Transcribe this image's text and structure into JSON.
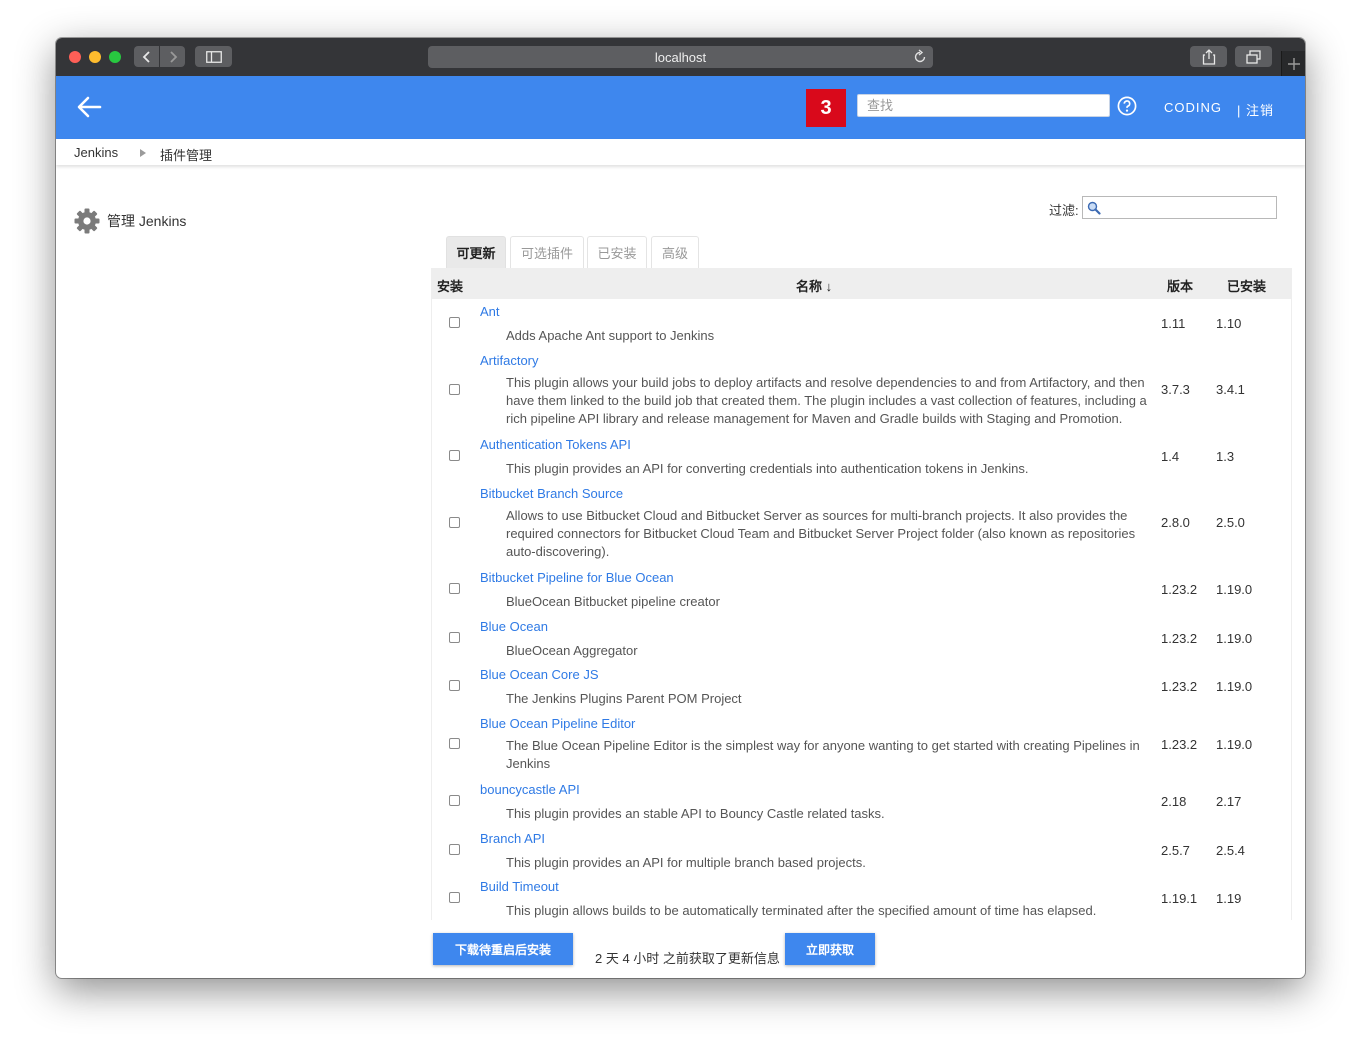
{
  "browser": {
    "url": "localhost"
  },
  "header": {
    "notification_count": "3",
    "search_placeholder": "查找",
    "user_link": "CODING",
    "logout_link": "| 注销"
  },
  "breadcrumb": [
    "Jenkins",
    "插件管理"
  ],
  "sidebar": {
    "manage_label": "管理 Jenkins"
  },
  "filter": {
    "label": "过滤:",
    "value": ""
  },
  "tabs": [
    "可更新",
    "可选插件",
    "已安装",
    "高级"
  ],
  "table": {
    "headers": {
      "install": "安装",
      "name": "名称 ↓",
      "version": "版本",
      "installed": "已安装"
    },
    "rows": [
      {
        "name": "Ant",
        "desc": "Adds Apache Ant support to Jenkins",
        "version": "1.11",
        "installed": "1.10"
      },
      {
        "name": "Artifactory",
        "desc": "This plugin allows your build jobs to deploy artifacts and resolve dependencies to and from Artifactory, and then have them linked to the build job that created them. The plugin includes a vast collection of features, including a rich pipeline API library and release management for Maven and Gradle builds with Staging and Promotion.",
        "version": "3.7.3",
        "installed": "3.4.1"
      },
      {
        "name": "Authentication Tokens API",
        "desc": "This plugin provides an API for converting credentials into authentication tokens in Jenkins.",
        "version": "1.4",
        "installed": "1.3"
      },
      {
        "name": "Bitbucket Branch Source",
        "desc": "Allows to use Bitbucket Cloud and Bitbucket Server as sources for multi-branch projects. It also provides the required connectors for Bitbucket Cloud Team and Bitbucket Server Project folder (also known as repositories auto-discovering).",
        "version": "2.8.0",
        "installed": "2.5.0"
      },
      {
        "name": "Bitbucket Pipeline for Blue Ocean",
        "desc": "BlueOcean Bitbucket pipeline creator",
        "version": "1.23.2",
        "installed": "1.19.0"
      },
      {
        "name": "Blue Ocean",
        "desc": "BlueOcean Aggregator",
        "version": "1.23.2",
        "installed": "1.19.0"
      },
      {
        "name": "Blue Ocean Core JS",
        "desc": "The Jenkins Plugins Parent POM Project",
        "version": "1.23.2",
        "installed": "1.19.0"
      },
      {
        "name": "Blue Ocean Pipeline Editor",
        "desc": "The Blue Ocean Pipeline Editor is the simplest way for anyone wanting to get started with creating Pipelines in Jenkins",
        "version": "1.23.2",
        "installed": "1.19.0"
      },
      {
        "name": "bouncycastle API",
        "desc": "This plugin provides an stable API to Bouncy Castle related tasks.",
        "version": "2.18",
        "installed": "2.17"
      },
      {
        "name": "Branch API",
        "desc": "This plugin provides an API for multiple branch based projects.",
        "version": "2.5.7",
        "installed": "2.5.4"
      },
      {
        "name": "Build Timeout",
        "desc": "This plugin allows builds to be automatically terminated after the specified amount of time has elapsed.",
        "version": "1.19.1",
        "installed": "1.19"
      }
    ]
  },
  "footer": {
    "download_button": "下载待重启后安装",
    "update_info": "2 天 4 小时 之前获取了更新信息",
    "fetch_button": "立即获取"
  }
}
